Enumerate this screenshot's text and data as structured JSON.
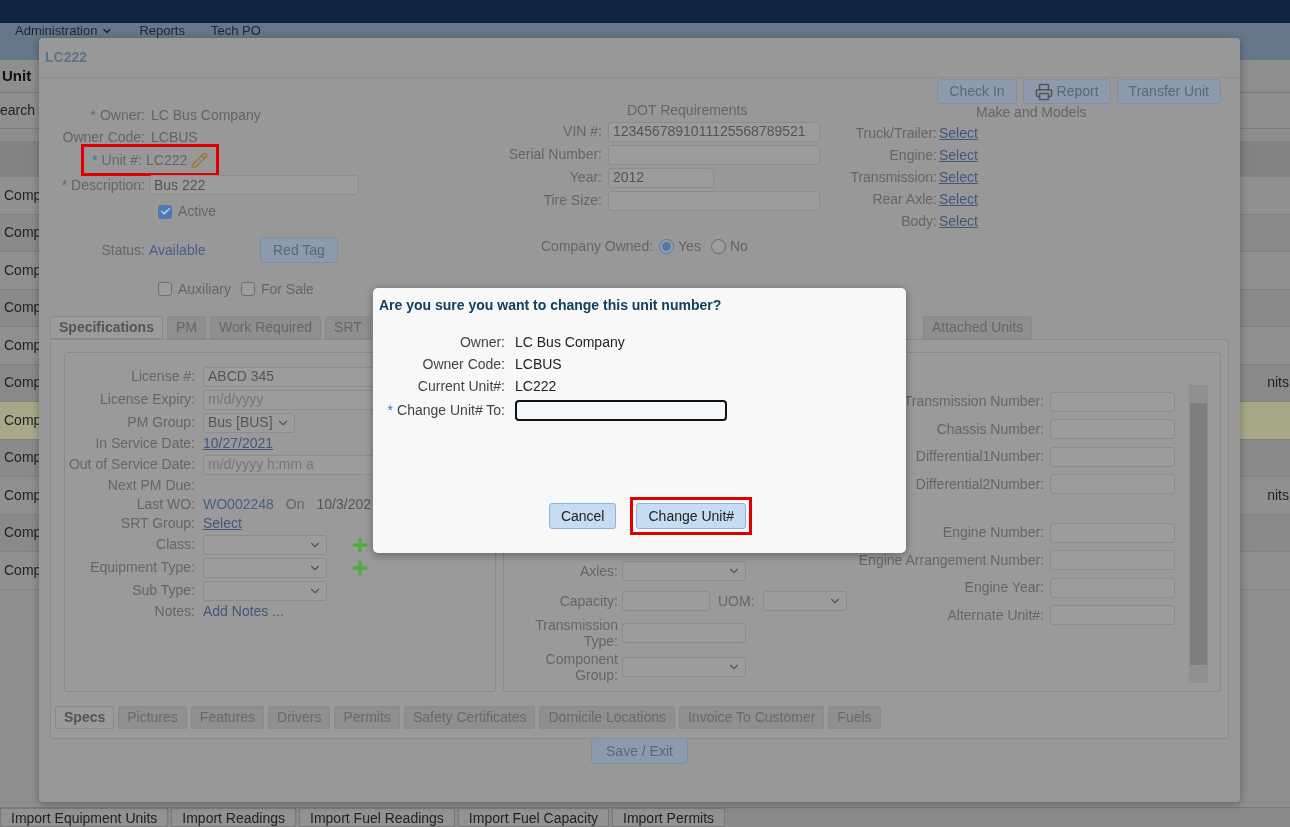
{
  "menu": [
    {
      "label": "Administration",
      "kind": "dropdown"
    },
    {
      "label": "Reports",
      "kind": "link"
    },
    {
      "label": "Tech PO",
      "kind": "link"
    }
  ],
  "background": {
    "heading": "Unit",
    "search_label": "earch",
    "rows": [
      {
        "cell": "Comp",
        "selected": false
      },
      {
        "cell": "Comp",
        "selected": false
      },
      {
        "cell": "Comp",
        "selected": false
      },
      {
        "cell": "Comp",
        "selected": false
      },
      {
        "cell": "Comp",
        "selected": false
      },
      {
        "cell": "Comp",
        "tail": "nits",
        "selected": false
      },
      {
        "cell": "Comp",
        "selected": true
      },
      {
        "cell": "Comp",
        "selected": false
      },
      {
        "cell": "Comp",
        "tail": "nits",
        "selected": false
      },
      {
        "cell": "Comp",
        "selected": false
      },
      {
        "cell": "Comp",
        "selected": false
      }
    ],
    "bottom_tabs": [
      "Import Equipment Units",
      "Import Readings",
      "Import Fuel Readings",
      "Import Fuel Capacity",
      "Import Permits"
    ]
  },
  "unit_window": {
    "title": "LC222",
    "actions": [
      {
        "label": "Check In",
        "kind": "plain"
      },
      {
        "label": "Report",
        "kind": "print"
      },
      {
        "label": "Transfer Unit",
        "kind": "plain"
      }
    ],
    "owner": {
      "mark": "*",
      "label": "Owner:",
      "value": "LC Bus Company"
    },
    "owner_code": {
      "label": "Owner Code:",
      "value": "LCBUS"
    },
    "unit": {
      "mark": "*",
      "label": "Unit #:",
      "value": "LC222",
      "highlighted": true
    },
    "description": {
      "mark": "*",
      "label": "Description:",
      "value": "Bus 222"
    },
    "active": {
      "label": "Active",
      "checked": true
    },
    "status": {
      "label": "Status:",
      "value": "Available"
    },
    "red_tag": "Red Tag",
    "flags": [
      {
        "label": "Auxiliary",
        "checked": false
      },
      {
        "label": "For Sale",
        "checked": false
      }
    ],
    "dot": {
      "heading": "DOT Requirements",
      "fields": [
        {
          "label": "VIN #:",
          "value": "1234567891011125568789521",
          "kind": "wide"
        },
        {
          "label": "Serial Number:",
          "kind": "wide"
        },
        {
          "label": "Year:",
          "value": "2012",
          "kind": "short"
        },
        {
          "label": "Tire Size:",
          "kind": "wide"
        }
      ]
    },
    "company_owned": {
      "label": "Company Owned:",
      "options": [
        {
          "label": "Yes",
          "selected": true
        },
        {
          "label": "No",
          "selected": false
        }
      ]
    },
    "make_models": {
      "heading": "Make and Models",
      "items": [
        {
          "label": "Truck/Trailer:",
          "link": "Select"
        },
        {
          "label": "Engine:",
          "link": "Select"
        },
        {
          "label": "Transmission:",
          "link": "Select"
        },
        {
          "label": "Rear Axle:",
          "link": "Select"
        },
        {
          "label": "Body:",
          "link": "Select"
        }
      ]
    },
    "tabs": [
      {
        "label": "Specifications",
        "selected": true
      },
      {
        "label": "PM",
        "selected": false
      },
      {
        "label": "Work Required",
        "selected": false
      },
      {
        "label": "SRT",
        "selected": false
      },
      {
        "label": "Attached Units",
        "selected": false
      }
    ],
    "spec_left": [
      {
        "label": "License #:",
        "kind": "input",
        "value": "ABCD 345"
      },
      {
        "label": "License Expiry:",
        "kind": "input",
        "placeholder": "m/d/yyyy"
      },
      {
        "label": "PM Group:",
        "kind": "select",
        "value": "Bus [BUS]"
      },
      {
        "label": "In Service Date:",
        "kind": "date_link",
        "value": "10/27/2021"
      },
      {
        "label": "Out of Service Date:",
        "kind": "input",
        "placeholder": "m/d/yyyy h:mm a"
      },
      {
        "label": "Next PM Due:",
        "kind": "text"
      },
      {
        "label": "Last WO:",
        "kind": "wo",
        "value": "WO002248",
        "on": "On",
        "date": "10/3/202"
      },
      {
        "label": "SRT Group:",
        "kind": "link",
        "value": "Select"
      },
      {
        "label": "Class:",
        "kind": "select_add"
      },
      {
        "label": "Equipment Type:",
        "kind": "select_add"
      },
      {
        "label": "Sub Type:",
        "kind": "select"
      },
      {
        "label": "Notes:",
        "kind": "notes",
        "value": "Add Notes ..."
      }
    ],
    "spec_middle": [
      {
        "label": "Axles:",
        "kind": "select"
      },
      {
        "label": "Capacity:",
        "kind": "capacity",
        "unit_label": "UOM:"
      },
      {
        "label": "Transmission Type:",
        "kind": "input"
      },
      {
        "label": "Component Group:",
        "kind": "select"
      }
    ],
    "spec_right": [
      {
        "fields": [
          {
            "label": "Transmission Number:"
          },
          {
            "label": "Chassis Number:"
          },
          {
            "label": "Differential1Number:"
          },
          {
            "label": "Differential2Number:"
          }
        ]
      },
      {
        "fields": [
          {
            "label": "Engine Number:"
          },
          {
            "label": "Engine Arrangement Number:"
          },
          {
            "label": "Engine Year:"
          },
          {
            "label": "Alternate Unit#:"
          }
        ]
      }
    ],
    "sub_tabs": [
      {
        "label": "Specs",
        "selected": true
      },
      {
        "label": "Pictures",
        "selected": false
      },
      {
        "label": "Features",
        "selected": false
      },
      {
        "label": "Drivers",
        "selected": false
      },
      {
        "label": "Permits",
        "selected": false
      },
      {
        "label": "Safety Certificates",
        "selected": false
      },
      {
        "label": "Domicile Locations",
        "selected": false
      },
      {
        "label": "Invoice To Customer",
        "selected": false
      },
      {
        "label": "Fuels",
        "selected": false
      }
    ],
    "save": "Save / Exit"
  },
  "dialog": {
    "title": "Are you sure you want to change this unit number?",
    "fields": [
      {
        "label": "Owner:",
        "value": "LC Bus Company"
      },
      {
        "label": "Owner Code:",
        "value": "LCBUS"
      },
      {
        "label": "Current Unit#:",
        "value": "LC222"
      }
    ],
    "input": {
      "mark": "*",
      "label": "Change Unit# To:",
      "focused": true
    },
    "buttons": [
      {
        "label": "Cancel",
        "highlighted": false
      },
      {
        "label": "Change Unit#",
        "highlighted": true
      }
    ]
  }
}
